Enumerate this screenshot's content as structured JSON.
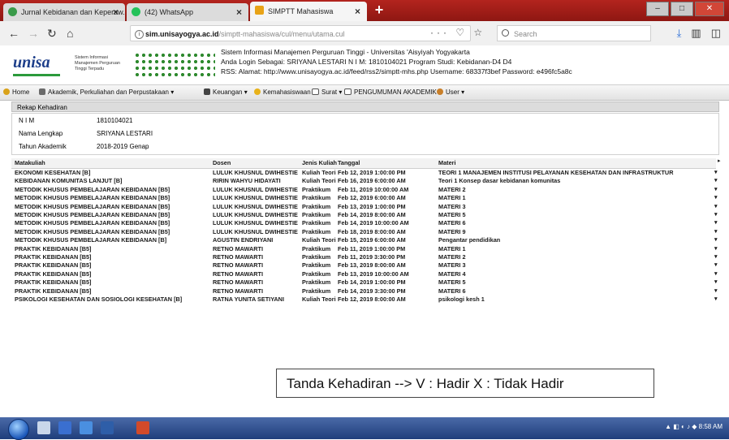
{
  "browser": {
    "tabs": [
      {
        "title": "Jurnal Kebidanan dan Keperaw...",
        "icon": "journal-icon",
        "active": false
      },
      {
        "title": "(42) WhatsApp",
        "icon": "whatsapp-icon",
        "active": false
      },
      {
        "title": "SIMPTT Mahasiswa",
        "icon": "simptt-icon",
        "active": true
      }
    ],
    "url_domain": "sim.unisayogya.ac.id",
    "url_path": "/simptt-mahasiswa/cul/menu/utama.cul",
    "search_placeholder": "Search"
  },
  "header": {
    "logo_text": "unisa",
    "system_name": "Sistem Informasi Manajemen Perguruan Tinggi Terpadu",
    "line1": "Sistem Informasi Manajemen Perguruan Tinggi - Universitas 'Aisyiyah Yogyakarta",
    "line2": "Anda Login Sebagai: SRIYANA LESTARI   N I M: 1810104021   Program Studi: Kebidanan-D4 D4",
    "line3": "RSS:   Alamat: http://www.unisayogya.ac.id/feed/rss2/simptt-mhs.php   Username: 68337f3bef   Password: e496fc5a8c"
  },
  "menu": {
    "home": "Home",
    "akademik": "Akademik, Perkuliahan dan Perpustakaan",
    "keuangan": "Keuangan",
    "kemahasiswaan": "Kemahasiswaan",
    "surat": "Surat",
    "pengumuman": "PENGUMUMAN AKADEMIK",
    "user": "User"
  },
  "panel": {
    "title": "Rekap Kehadiran",
    "nim_label": "N I M",
    "nim_value": "1810104021",
    "nama_label": "Nama Lengkap",
    "nama_value": "SRIYANA LESTARI",
    "tahun_label": "Tahun Akademik",
    "tahun_value": "2018-2019 Genap"
  },
  "table": {
    "headers": [
      "Matakuliah",
      "Dosen",
      "Jenis Kuliah",
      "Tanggal",
      "Materi"
    ],
    "rows": [
      [
        "EKONOMI KESEHATAN [B]",
        "LULUK KHUSNUL DWIHESTIE",
        "Kuliah Teori",
        "Feb 12, 2019 1:00:00 PM",
        "TEORI 1 MANAJEMEN INSTITUSI PELAYANAN KESEHATAN DAN INFRASTRUKTUR"
      ],
      [
        "KEBIDANAN KOMUNITAS LANJUT [B]",
        "RIRIN WAHYU HIDAYATI",
        "Kuliah Teori",
        "Feb 16, 2019 6:00:00 AM",
        "Teori 1 Konsep dasar kebidanan komunitas"
      ],
      [
        "METODIK KHUSUS PEMBELAJARAN KEBIDANAN [B5]",
        "LULUK KHUSNUL DWIHESTIE",
        "Praktikum",
        "Feb 11, 2019 10:00:00 AM",
        "MATERI 2"
      ],
      [
        "METODIK KHUSUS PEMBELAJARAN KEBIDANAN [B5]",
        "LULUK KHUSNUL DWIHESTIE",
        "Praktikum",
        "Feb 12, 2019 6:00:00 AM",
        "MATERI 1"
      ],
      [
        "METODIK KHUSUS PEMBELAJARAN KEBIDANAN [B5]",
        "LULUK KHUSNUL DWIHESTIE",
        "Praktikum",
        "Feb 13, 2019 1:00:00 PM",
        "MATERI 3"
      ],
      [
        "METODIK KHUSUS PEMBELAJARAN KEBIDANAN [B5]",
        "LULUK KHUSNUL DWIHESTIE",
        "Praktikum",
        "Feb 14, 2019 8:00:00 AM",
        "MATERI 5"
      ],
      [
        "METODIK KHUSUS PEMBELAJARAN KEBIDANAN [B5]",
        "LULUK KHUSNUL DWIHESTIE",
        "Praktikum",
        "Feb 14, 2019 10:00:00 AM",
        "MATERI 6"
      ],
      [
        "METODIK KHUSUS PEMBELAJARAN KEBIDANAN [B5]",
        "LULUK KHUSNUL DWIHESTIE",
        "Praktikum",
        "Feb 18, 2019 8:00:00 AM",
        "MATERI 9"
      ],
      [
        "METODIK KHUSUS PEMBELAJARAN KEBIDANAN [B]",
        "AGUSTIN ENDRIYANI",
        "Kuliah Teori",
        "Feb 15, 2019 6:00:00 AM",
        "Pengantar pendidikan"
      ],
      [
        "PRAKTIK KEBIDANAN [B5]",
        "RETNO MAWARTI",
        "Praktikum",
        "Feb 11, 2019 1:00:00 PM",
        "MATERI 1"
      ],
      [
        "PRAKTIK KEBIDANAN [B5]",
        "RETNO MAWARTI",
        "Praktikum",
        "Feb 11, 2019 3:30:00 PM",
        "MATERI 2"
      ],
      [
        "PRAKTIK KEBIDANAN [B5]",
        "RETNO MAWARTI",
        "Praktikum",
        "Feb 13, 2019 8:00:00 AM",
        "MATERI 3"
      ],
      [
        "PRAKTIK KEBIDANAN [B5]",
        "RETNO MAWARTI",
        "Praktikum",
        "Feb 13, 2019 10:00:00 AM",
        "MATERI 4"
      ],
      [
        "PRAKTIK KEBIDANAN [B5]",
        "RETNO MAWARTI",
        "Praktikum",
        "Feb 14, 2019 1:00:00 PM",
        "MATERI 5"
      ],
      [
        "PRAKTIK KEBIDANAN [B5]",
        "RETNO MAWARTI",
        "Praktikum",
        "Feb 14, 2019 3:30:00 PM",
        "MATERI 6"
      ],
      [
        "PSIKOLOGI KESEHATAN DAN SOSIOLOGI KESEHATAN [B]",
        "RATNA YUNITA SETIYANI",
        "Kuliah Teori",
        "Feb 12, 2019 8:00:00 AM",
        "psikologi kesh 1"
      ]
    ]
  },
  "note": "Tanda Kehadiran --> V : Hadir     X : Tidak Hadir",
  "taskbar": {
    "clock": "8:58 AM"
  },
  "colors": {
    "tabstrip": "#a31f1a",
    "logo_blue": "#1d3e8a",
    "logo_green": "#2b9a3b",
    "taskbar": "#2a4a8a"
  }
}
